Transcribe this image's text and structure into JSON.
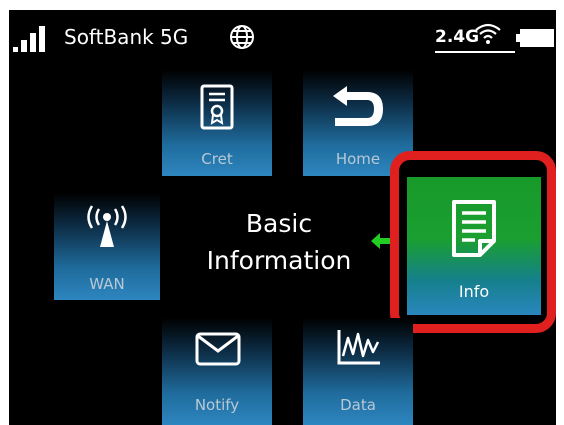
{
  "status_bar": {
    "carrier": "SoftBank 5G",
    "wifi_band": "2.4G",
    "signal_icon": "signal-bars-icon",
    "network_icon": "globe-icon",
    "wifi_icon": "wifi-icon",
    "battery_icon": "battery-icon"
  },
  "menu": {
    "center_title_line1": "Basic",
    "center_title_line2": "Information",
    "tiles": {
      "cret": "Cret",
      "home": "Home",
      "wan": "WAN",
      "info": "Info",
      "notify": "Notify",
      "data": "Data"
    }
  },
  "colors": {
    "highlight_border": "#e0201e",
    "info_tile": "#1a9f30",
    "arrow": "#22cc22"
  }
}
